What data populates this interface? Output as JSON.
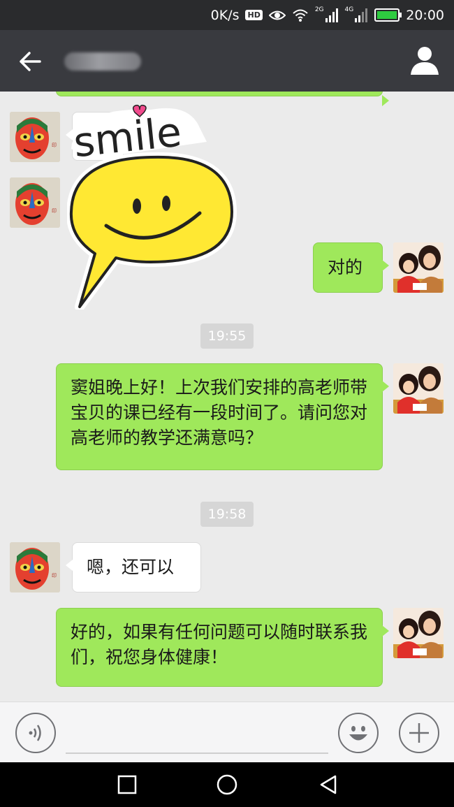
{
  "status_bar": {
    "speed": "0K/s",
    "hd_badge": "HD",
    "net1": "2G",
    "net2": "4G",
    "time": "20:00"
  },
  "title_bar": {
    "contact_name": ""
  },
  "messages": {
    "m1": "对的",
    "ts1": "19:55",
    "m2": "窦姐晚上好！上次我们安排的高老师带宝贝的课已经有一段时间了。请问您对高老师的教学还满意吗？",
    "ts2": "19:58",
    "m3": "嗯，还可以",
    "m4": "好的，如果有任何问题可以随时联系我们，祝您身体健康！"
  },
  "sticker": {
    "text": "smile"
  },
  "input": {
    "value": ""
  },
  "colors": {
    "my_bubble": "#9fe85b",
    "other_bubble": "#ffffff",
    "title_bar": "#393a3f",
    "chat_bg": "#ebebeb"
  },
  "icons": {
    "back": "arrow-left-icon",
    "profile": "person-icon",
    "voice": "voice-wave-icon",
    "emoji": "smiley-icon",
    "plus": "plus-icon",
    "eye": "eye-icon",
    "wifi": "wifi-icon",
    "signal": "signal-bars-icon",
    "battery": "battery-charging-icon",
    "nav_back": "triangle-back-icon",
    "nav_home": "circle-home-icon",
    "nav_recent": "square-recent-icon"
  }
}
